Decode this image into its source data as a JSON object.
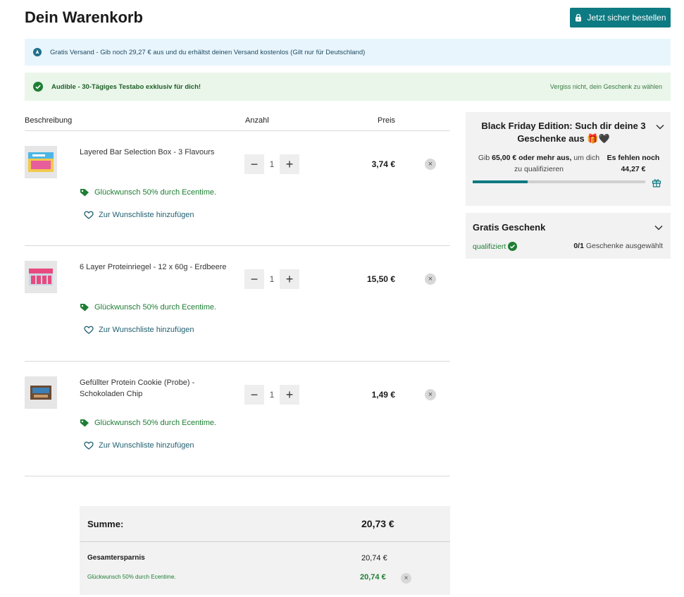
{
  "header": {
    "title": "Dein Warenkorb",
    "checkout_label": "Jetzt sicher bestellen"
  },
  "banners": {
    "shipping": "Gratis Versand - Gib noch 29,27 € aus und du erhältst deinen Versand kostenlos (Gilt nur für Deutschland)",
    "gift_offer": "Audible - 30-Tägiges Testabo exklusiv für dich!",
    "gift_reminder": "Vergiss nicht, dein Geschenk zu wählen"
  },
  "table": {
    "col_description": "Beschreibung",
    "col_quantity": "Anzahl",
    "col_price": "Preis"
  },
  "items": [
    {
      "name": "Layered Bar Selection Box - 3 Flavours",
      "quantity": "1",
      "price": "3,74 €",
      "promo": "Glückwunsch 50% durch Ecentime.",
      "wishlist": "Zur Wunschliste hinzufügen"
    },
    {
      "name": "6 Layer Proteinriegel - 12 x 60g - Erdbeere",
      "quantity": "1",
      "price": "15,50 €",
      "promo": "Glückwunsch 50% durch Ecentime.",
      "wishlist": "Zur Wunschliste hinzufügen"
    },
    {
      "name": "Gefüllter Protein Cookie (Probe) - Schokoladen Chip",
      "quantity": "1",
      "price": "1,49 €",
      "promo": "Glückwunsch 50% durch Ecentime.",
      "wishlist": "Zur Wunschliste hinzufügen"
    }
  ],
  "summary": {
    "total_label": "Summe:",
    "total_value": "20,73 €",
    "savings_label": "Gesamtersparnis",
    "savings_value": "20,74 €",
    "promo_label": "Glückwunsch 50% durch Ecentime.",
    "promo_value": "20,74 €"
  },
  "black_friday": {
    "title": "Black Friday Edition: Such dir deine 3 Geschenke aus 🎁🖤",
    "text_prefix": "Gib ",
    "amount_bold": "65,00 € oder mehr aus,",
    "text_suffix": " um dich zu qualifizieren",
    "missing_label": "Es fehlen noch",
    "missing_value": "44,27 €",
    "progress_fraction": 0.32
  },
  "gratis_gift": {
    "title": "Gratis Geschenk",
    "status": "qualifiziert",
    "count_bold": "0/1",
    "count_text": " Geschenke ausgewählt"
  },
  "colors": {
    "accent": "#0e7a82",
    "success": "#1e7e34"
  }
}
